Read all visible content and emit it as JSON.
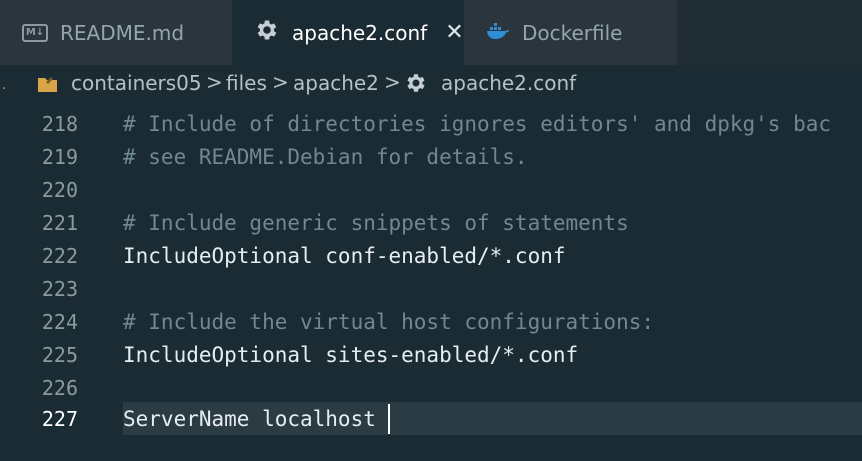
{
  "tabs": [
    {
      "label": "README.md",
      "icon": "markdown-icon",
      "icon_text": "M↓",
      "active": false
    },
    {
      "label": "apache2.conf",
      "icon": "gear-icon",
      "active": true,
      "close": "✕"
    },
    {
      "label": "Dockerfile",
      "icon": "docker-icon",
      "active": false
    }
  ],
  "breadcrumb": {
    "dot": ".",
    "parts": [
      "containers05",
      "files",
      "apache2",
      "apache2.conf"
    ],
    "separator": ">"
  },
  "editor": {
    "lines": [
      {
        "num": "218",
        "text": "# Include of directories ignores editors' and dpkg's bac",
        "type": "comment"
      },
      {
        "num": "219",
        "text": "# see README.Debian for details.",
        "type": "comment"
      },
      {
        "num": "220",
        "text": "",
        "type": "code"
      },
      {
        "num": "221",
        "text": "# Include generic snippets of statements",
        "type": "comment"
      },
      {
        "num": "222",
        "text": "IncludeOptional conf-enabled/*.conf",
        "type": "code"
      },
      {
        "num": "223",
        "text": "",
        "type": "code"
      },
      {
        "num": "224",
        "text": "# Include the virtual host configurations:",
        "type": "comment"
      },
      {
        "num": "225",
        "text": "IncludeOptional sites-enabled/*.conf",
        "type": "code"
      },
      {
        "num": "226",
        "text": "",
        "type": "code"
      },
      {
        "num": "227",
        "text": "ServerName localhost",
        "type": "code",
        "current": true
      }
    ]
  },
  "colors": {
    "background": "#1b2b34",
    "tab_inactive": "#2a363c",
    "comment": "#6f8893",
    "code": "#e6edf0",
    "docker_blue": "#2f8fd6",
    "folder_yellow": "#d9a548",
    "gear_gray": "#c5ced2"
  }
}
